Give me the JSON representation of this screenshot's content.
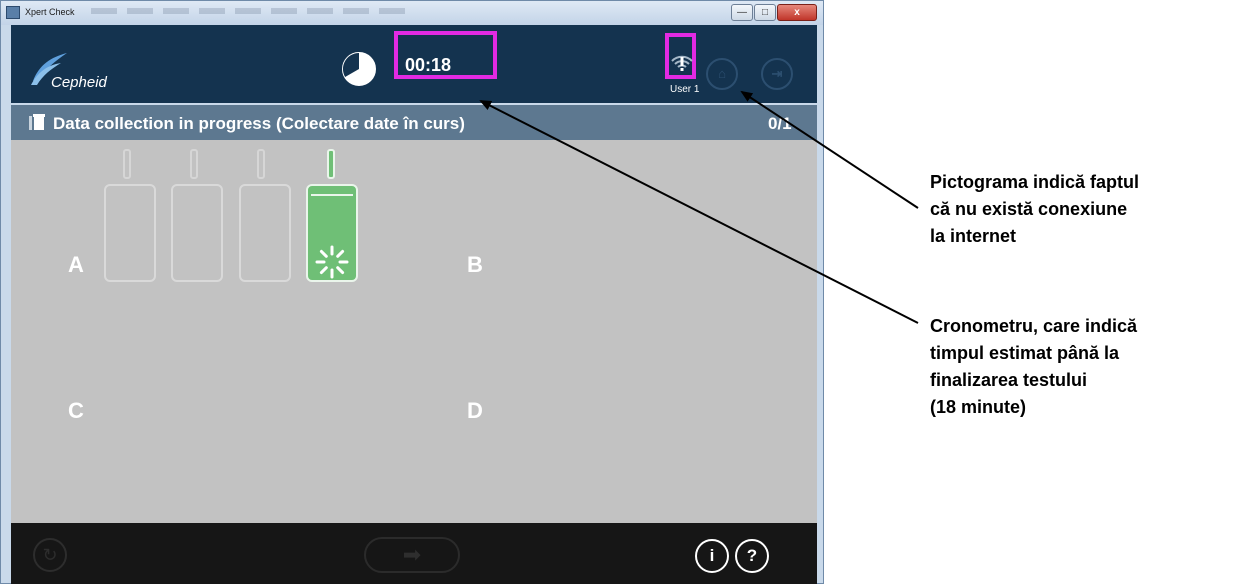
{
  "window": {
    "title": "Xpert Check",
    "min_glyph": "—",
    "max_glyph": "□",
    "close_glyph": "x"
  },
  "header": {
    "brand": "Cepheid",
    "timer": "00:18",
    "user": "User 1",
    "home_glyph": "⌂",
    "exit_glyph": "⇥",
    "network_icon": "no-internet-warning-icon"
  },
  "status": {
    "text": "Data collection in progress (Colectare date în curs)",
    "count": "0/1"
  },
  "modules": {
    "quadrants": [
      "A",
      "B",
      "C",
      "D"
    ],
    "active_module": 4,
    "total_modules": 4
  },
  "footer": {
    "refresh_glyph": "↻",
    "next_glyph": "➡",
    "info_glyph": "i",
    "help_glyph": "?"
  },
  "annotations": {
    "network": [
      "Pictograma indică faptul",
      "că nu există conexiune",
      "la internet"
    ],
    "timer": [
      "Cronometru, care indică",
      "timpul estimat până la",
      "finalizarea testului",
      "(18 minute)"
    ]
  },
  "colors": {
    "header_bg": "#14334f",
    "status_bg": "#5d7890",
    "main_bg": "#c2c2c2",
    "active_module": "#6fbf76",
    "highlight": "#e22ae2"
  }
}
